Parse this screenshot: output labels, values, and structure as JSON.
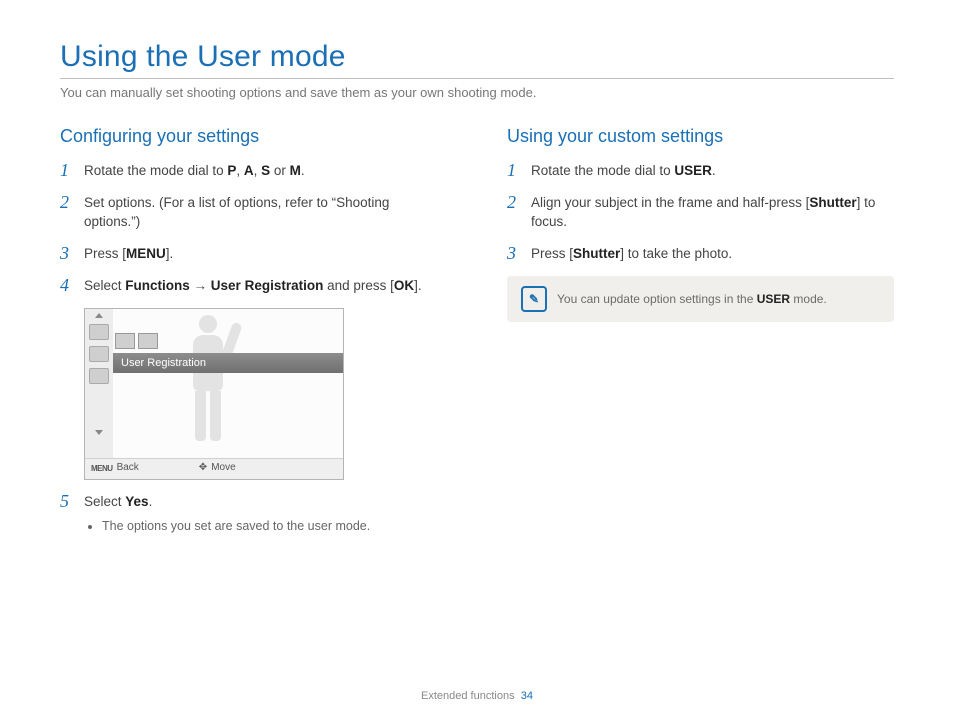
{
  "title": "Using the User mode",
  "intro": "You can manually set shooting options and save them as your own shooting mode.",
  "left": {
    "heading": "Configuring your settings",
    "steps": [
      {
        "n": "1",
        "pre": "Rotate the mode dial to ",
        "sym1": "P",
        "mid1": ", ",
        "sym2": "A",
        "mid2": ", ",
        "sym3": "S",
        "mid3": " or ",
        "sym4": "M",
        "post": "."
      },
      {
        "n": "2",
        "text": "Set options. (For a list of options, refer to “Shooting options.”)"
      },
      {
        "n": "3",
        "pre": "Press [",
        "sym1": "MENU",
        "post": "]."
      },
      {
        "n": "4",
        "pre": "Select ",
        "b1": "Functions",
        "mid1": " → ",
        "b2": "User Registration",
        "mid2": " and press [",
        "sym1": "OK",
        "post": "]."
      },
      {
        "n": "5",
        "pre": "Select ",
        "b1": "Yes",
        "post": ".",
        "sub": "The options you set are saved to the user mode."
      }
    ],
    "lcd": {
      "selected": "User Registration",
      "back": "Back",
      "move": "Move",
      "menu": "MENU"
    }
  },
  "right": {
    "heading": "Using your custom settings",
    "steps": [
      {
        "n": "1",
        "pre": "Rotate the mode dial to ",
        "sym1": "USER",
        "post": "."
      },
      {
        "n": "2",
        "pre": "Align your subject in the frame and half-press [",
        "b1": "Shutter",
        "post": "] to focus."
      },
      {
        "n": "3",
        "pre": "Press [",
        "b1": "Shutter",
        "post": "] to take the photo."
      }
    ],
    "note": {
      "pre": "You can update option settings in the ",
      "sym": "USER",
      "post": " mode."
    }
  },
  "footer": {
    "section": "Extended functions",
    "page": "34"
  }
}
